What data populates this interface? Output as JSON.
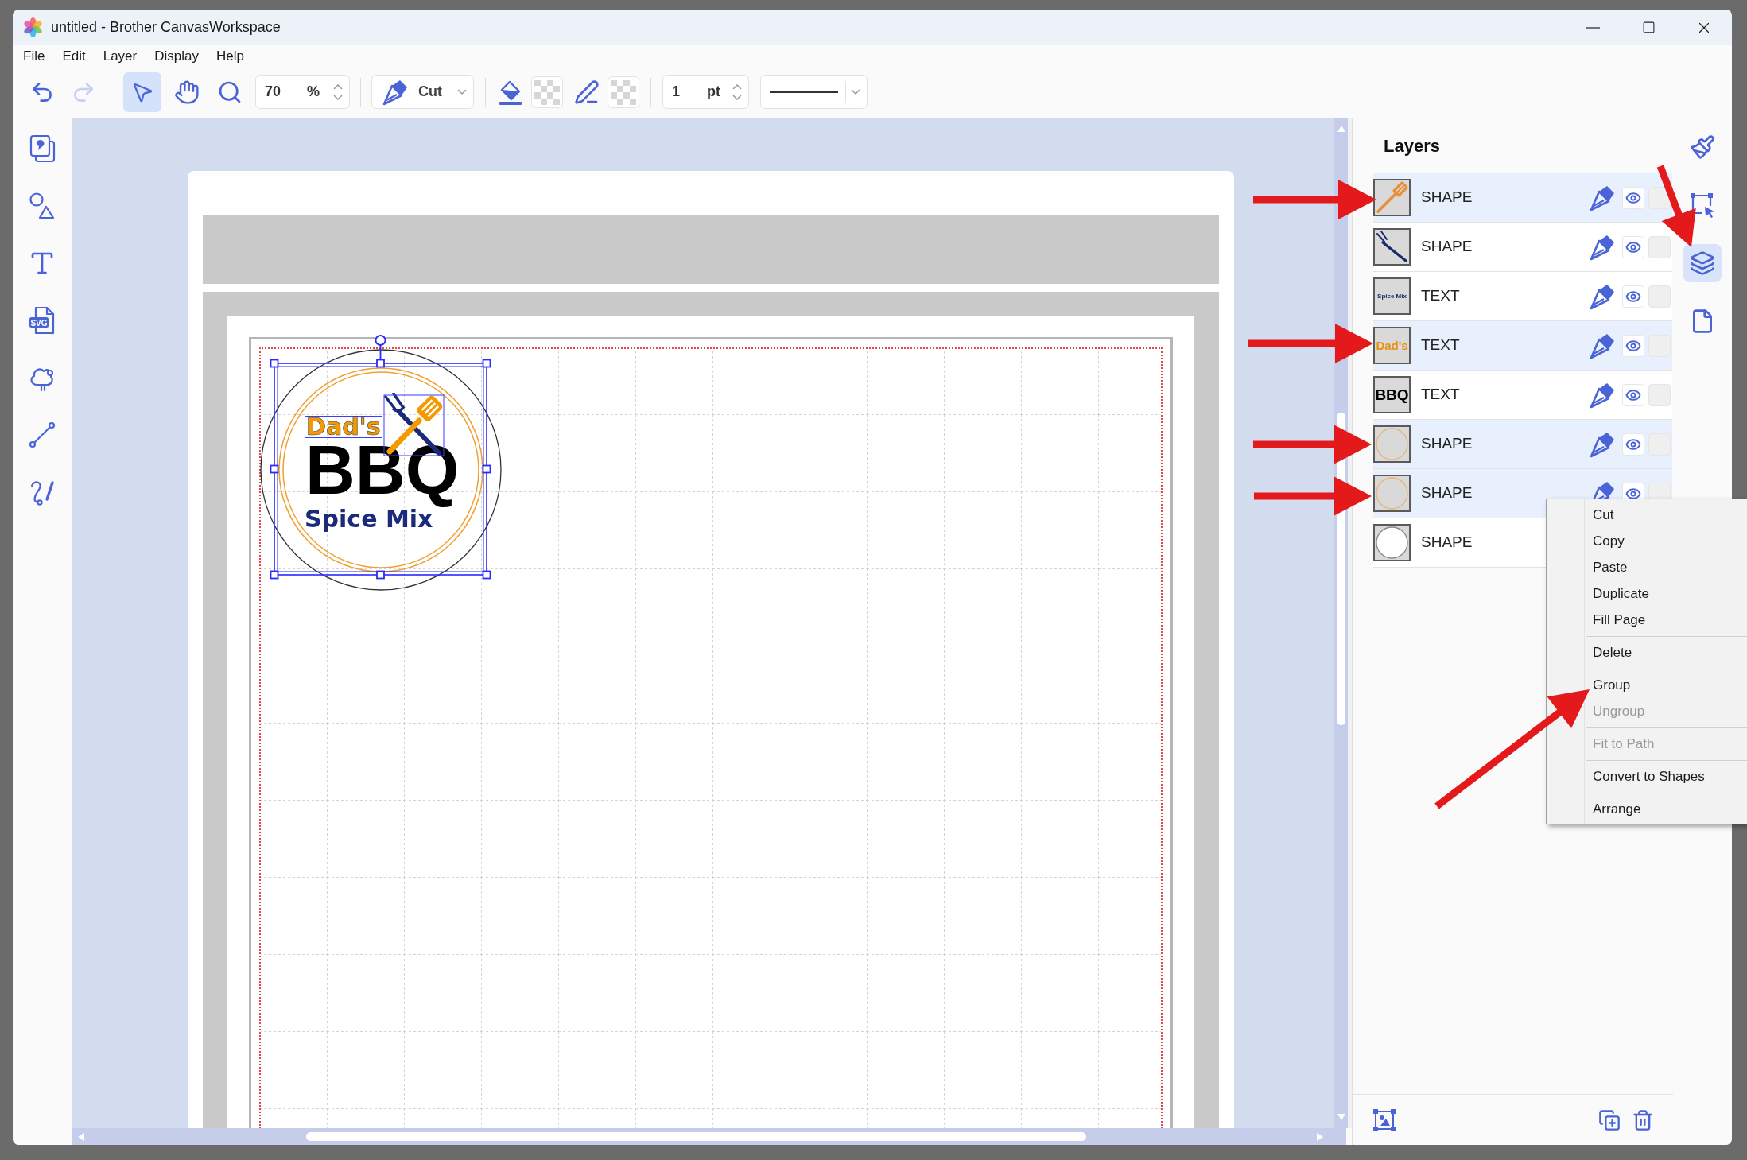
{
  "window": {
    "title": "untitled - Brother CanvasWorkspace"
  },
  "menu_bar": [
    "File",
    "Edit",
    "Layer",
    "Display",
    "Help"
  ],
  "toolbar": {
    "history": [
      {
        "kind": "undo",
        "disabled": false
      },
      {
        "kind": "redo",
        "disabled": true
      }
    ],
    "tools": [
      {
        "kind": "select",
        "selected": true
      },
      {
        "kind": "hand",
        "selected": false
      },
      {
        "kind": "zoom",
        "selected": false
      }
    ],
    "zoom_field": {
      "value": "70",
      "unit": "%"
    },
    "line_mode": {
      "value": "Cut"
    },
    "line_width_field": {
      "value": "1",
      "unit": "pt"
    }
  },
  "left_toolbar": [
    {
      "kind": "pages"
    },
    {
      "kind": "shapes"
    },
    {
      "kind": "text"
    },
    {
      "kind": "svg",
      "label": "SVG"
    },
    {
      "kind": "cloud"
    },
    {
      "kind": "line"
    },
    {
      "kind": "freehand"
    }
  ],
  "canvas": {
    "logo": {
      "top_text": "Dad's",
      "main_text": "BBQ",
      "bottom_text": "Spice Mix"
    }
  },
  "layers": {
    "title": "Layers",
    "items": [
      {
        "type": "SHAPE",
        "kind": "spatula",
        "selected": true
      },
      {
        "type": "SHAPE",
        "kind": "fork",
        "selected": false
      },
      {
        "type": "TEXT",
        "kind": "text",
        "thumb_text": "Spice Mix",
        "color": "#1c2a6e",
        "selected": false
      },
      {
        "type": "TEXT",
        "kind": "text",
        "thumb_text": "Dad's",
        "color": "#e8900a",
        "selected": true
      },
      {
        "type": "TEXT",
        "kind": "text",
        "thumb_text": "BBQ",
        "color": "#000000",
        "selected": false
      },
      {
        "type": "SHAPE",
        "kind": "ring",
        "selected": true
      },
      {
        "type": "SHAPE",
        "kind": "ring",
        "selected": true
      },
      {
        "type": "SHAPE",
        "kind": "circle",
        "selected": false
      }
    ]
  },
  "side_tabs": [
    {
      "kind": "brush",
      "selected": false
    },
    {
      "kind": "transform",
      "selected": false
    },
    {
      "kind": "layers",
      "selected": true
    },
    {
      "kind": "page",
      "selected": false
    }
  ],
  "context_menu": {
    "items": [
      {
        "kind": "item",
        "label": "Cut",
        "disabled": false
      },
      {
        "kind": "item",
        "label": "Copy",
        "disabled": false
      },
      {
        "kind": "item",
        "label": "Paste",
        "disabled": false
      },
      {
        "kind": "item",
        "label": "Duplicate",
        "disabled": false
      },
      {
        "kind": "item",
        "label": "Fill Page",
        "disabled": false
      },
      {
        "kind": "separator"
      },
      {
        "kind": "item",
        "label": "Delete",
        "disabled": false
      },
      {
        "kind": "separator"
      },
      {
        "kind": "item",
        "label": "Group",
        "disabled": false
      },
      {
        "kind": "item",
        "label": "Ungroup",
        "disabled": true
      },
      {
        "kind": "separator"
      },
      {
        "kind": "item",
        "label": "Fit to Path",
        "disabled": true
      },
      {
        "kind": "separator"
      },
      {
        "kind": "item",
        "label": "Convert to Shapes",
        "disabled": false
      },
      {
        "kind": "separator"
      },
      {
        "kind": "item",
        "label": "Arrange",
        "disabled": false
      }
    ]
  }
}
